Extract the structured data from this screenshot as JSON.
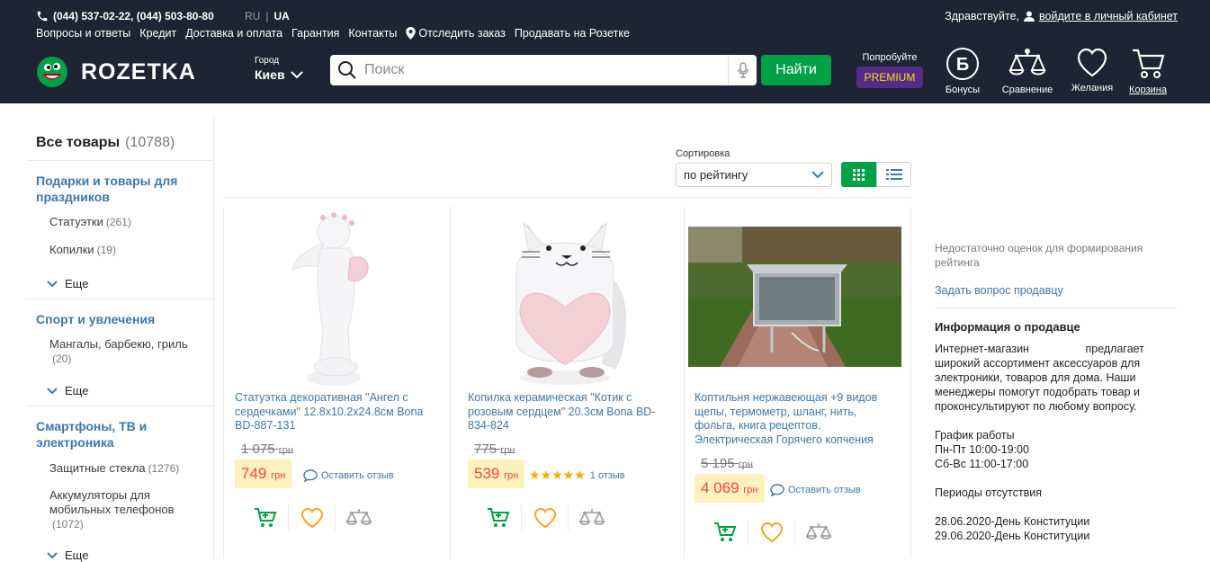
{
  "header": {
    "phones": "(044) 537-02-22, (044) 503-80-80",
    "lang_ru": "RU",
    "lang_ua": "UA",
    "greeting": "Здравствуйте,",
    "login": "войдите в личный кабинет",
    "nav": [
      "Вопросы и ответы",
      "Кредит",
      "Доставка и оплата",
      "Гарантия",
      "Контакты",
      "Отследить заказ",
      "Продавать на Розетке"
    ],
    "logo": "ROZETKA",
    "city_label": "Город",
    "city": "Киев",
    "search_placeholder": "Поиск",
    "search_button": "Найти",
    "try": "Попробуйте",
    "premium": "PREMIUM",
    "icons": {
      "bonus": "Бонусы",
      "compare": "Сравнение",
      "wishlist": "Желания",
      "cart": "Корзина"
    }
  },
  "sidebar": {
    "all": "Все товары",
    "all_count": "(10788)",
    "cat1": "Подарки и товары для праздников",
    "cat1_items": [
      {
        "label": "Статуэтки",
        "count": "(261)"
      },
      {
        "label": "Копилки",
        "count": "(19)"
      }
    ],
    "cat2": "Спорт и увлечения",
    "cat2_items": [
      {
        "label": "Мангалы, барбекю, гриль",
        "count": "(20)"
      }
    ],
    "cat3": "Смартфоны, ТВ и электроника",
    "cat3_items": [
      {
        "label": "Защитные стекла",
        "count": "(1276)"
      },
      {
        "label": "Аккумуляторы для мобильных телефонов",
        "count": "(1072)"
      }
    ],
    "more": "Еще"
  },
  "sort": {
    "label": "Сортировка",
    "value": "по рейтингу"
  },
  "products": [
    {
      "title": "Статуэтка декоративная \"Ангел с сердечками\" 12.8x10.2x24.8см Bona BD-887-131",
      "old": "1 075",
      "price": "749",
      "currency": "грн",
      "review": "Оставить отзыв"
    },
    {
      "title": "Копилка керамическая \"Котик с розовым сердцем\" 20.3см Bona BD-834-824",
      "old": "775",
      "price": "539",
      "currency": "грн",
      "reviews": "1 отзыв"
    },
    {
      "title": "Коптильня нержавеющая +9 видов щепы, термометр, шланг, нить, фольга, книга рецептов. Электрическая Горячего копчения",
      "old": "5 195",
      "price": "4 069",
      "currency": "грн",
      "review": "Оставить отзыв"
    }
  ],
  "seller": {
    "not_enough": "Недостаточно оценок для формирования рейтинга",
    "ask": "Задать вопрос продавцу",
    "info_title": "Информация о продавце",
    "info_text": "Интернет-магазин                  предлагает широкий ассортимент аксессуаров для электроники, товаров для дома. Наши менеджеры помогут подобрать товар и проконсультируют по любому вопросу.",
    "sched_title": "График работы",
    "sched1": "Пн-Пт 10:00-19:00",
    "sched2": "Сб-Вс 11:00-17:00",
    "periods": "Периоды отсутствия",
    "date1": "28.06.2020-День Конституции",
    "date2": "29.06.2020-День Конституции"
  },
  "colors": {
    "header": "#1e2433",
    "green": "#00a046",
    "link": "#3e77aa",
    "price": "#f84147",
    "premium": "#542d8b"
  }
}
